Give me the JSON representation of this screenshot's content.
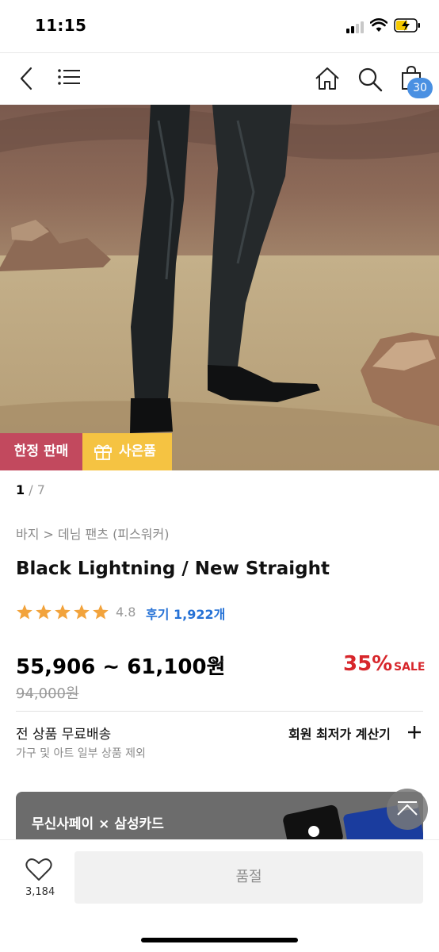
{
  "status_bar": {
    "time": "11:15"
  },
  "nav": {
    "cart_count": "30"
  },
  "badges": {
    "limited": "한정 판매",
    "gift": "사은품"
  },
  "pager": {
    "current": "1",
    "separator": "/",
    "total": "7"
  },
  "product": {
    "breadcrumb": "바지 > 데님 팬츠 (피스워커)",
    "title": "Black Lightning / New Straight",
    "rating": "4.8",
    "review_label": "후기 1,922개",
    "price": "55,906 ~ 61,100원",
    "discount": "35%",
    "sale_label": "SALE",
    "original_price": "94,000원"
  },
  "shipping": {
    "title": "전 상품 무료배송",
    "subtitle": "가구 및 아트 일부 상품 제외",
    "calculator_label": "회원 최저가 계산기"
  },
  "promo": {
    "text": "무신사페이 × 삼성카드"
  },
  "bottom": {
    "like_count": "3,184",
    "soldout_label": "품절"
  },
  "colors": {
    "accent": "#2672d6",
    "discount": "#d7262b",
    "limited": "#c2495e",
    "gift": "#f5c342",
    "badge": "#4a90e2"
  }
}
